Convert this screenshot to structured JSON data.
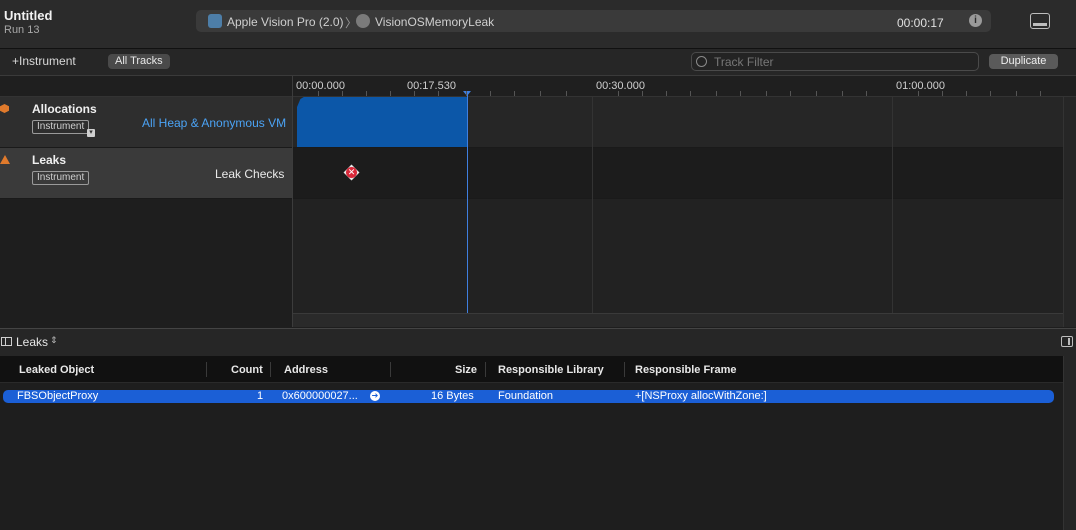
{
  "window": {
    "title": "Untitled",
    "run": "Run 13"
  },
  "target": {
    "device": "Apple Vision Pro (2.0)",
    "separator": "〉",
    "app": "VisionOSMemoryLeak",
    "elapsed": "00:00:17",
    "info_icon": "info-icon"
  },
  "toolbar": {
    "add_instrument": "+Instrument",
    "all_tracks": "All Tracks",
    "filter_placeholder": "Track Filter",
    "duplicate": "Duplicate"
  },
  "timeline": {
    "ticks": [
      "00:00.000",
      "00:17.530",
      "00:30.000",
      "01:00.000"
    ],
    "playhead_time": "00:17.530"
  },
  "tracks": [
    {
      "name": "Allocations",
      "type": "Instrument",
      "detail": "All Heap & Anonymous VM",
      "icon": "allocations-icon",
      "detail_color": "#4ba3f5"
    },
    {
      "name": "Leaks",
      "type": "Instrument",
      "detail": "Leak Checks",
      "icon": "leaks-icon"
    }
  ],
  "detail": {
    "view": "Leaks",
    "columns": [
      "Leaked Object",
      "Count",
      "Address",
      "Size",
      "Responsible Library",
      "Responsible Frame"
    ],
    "rows": [
      {
        "leaked_object": "FBSObjectProxy",
        "count": "1",
        "address": "0x600000027...",
        "size": "16 Bytes",
        "library": "Foundation",
        "frame": "+[NSProxy allocWithZone:]"
      }
    ]
  },
  "colors": {
    "accent": "#1b5fd6",
    "allocations_fill": "#0c57a8",
    "leak_marker": "#d8293a",
    "track_icon": "#e07a2c"
  }
}
